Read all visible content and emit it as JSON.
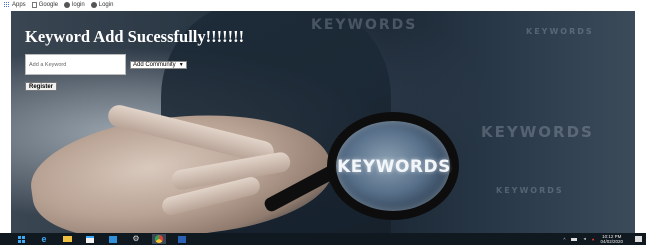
{
  "bookmarks": [
    {
      "label": "Apps",
      "icon": "apps-grid-icon"
    },
    {
      "label": "Google",
      "icon": "google-doc-icon"
    },
    {
      "label": "login",
      "icon": "globe-icon"
    },
    {
      "label": "Login",
      "icon": "globe-icon"
    }
  ],
  "page": {
    "heading": "Keyword Add Sucessfully!!!!!!!",
    "keyword_placeholder": "Add a Keyword",
    "community_select": "Add Community",
    "register_label": "Register"
  },
  "hero": {
    "lens_text": "KEYWORDS",
    "background_words": [
      "KEYWORDS",
      "KEYWORDS",
      "KEYWORDS",
      "KEYWORDS"
    ]
  },
  "taskbar": {
    "icons": [
      "windows-start-icon",
      "edge-icon",
      "file-explorer-icon",
      "store-icon",
      "photos-icon",
      "settings-icon",
      "chrome-icon",
      "word-icon"
    ],
    "time": "10:12 PM",
    "date": "04/02/2020"
  },
  "colors": {
    "heading": "#ffffff",
    "taskbar": "#101820",
    "accent": "#3fa9f5"
  }
}
